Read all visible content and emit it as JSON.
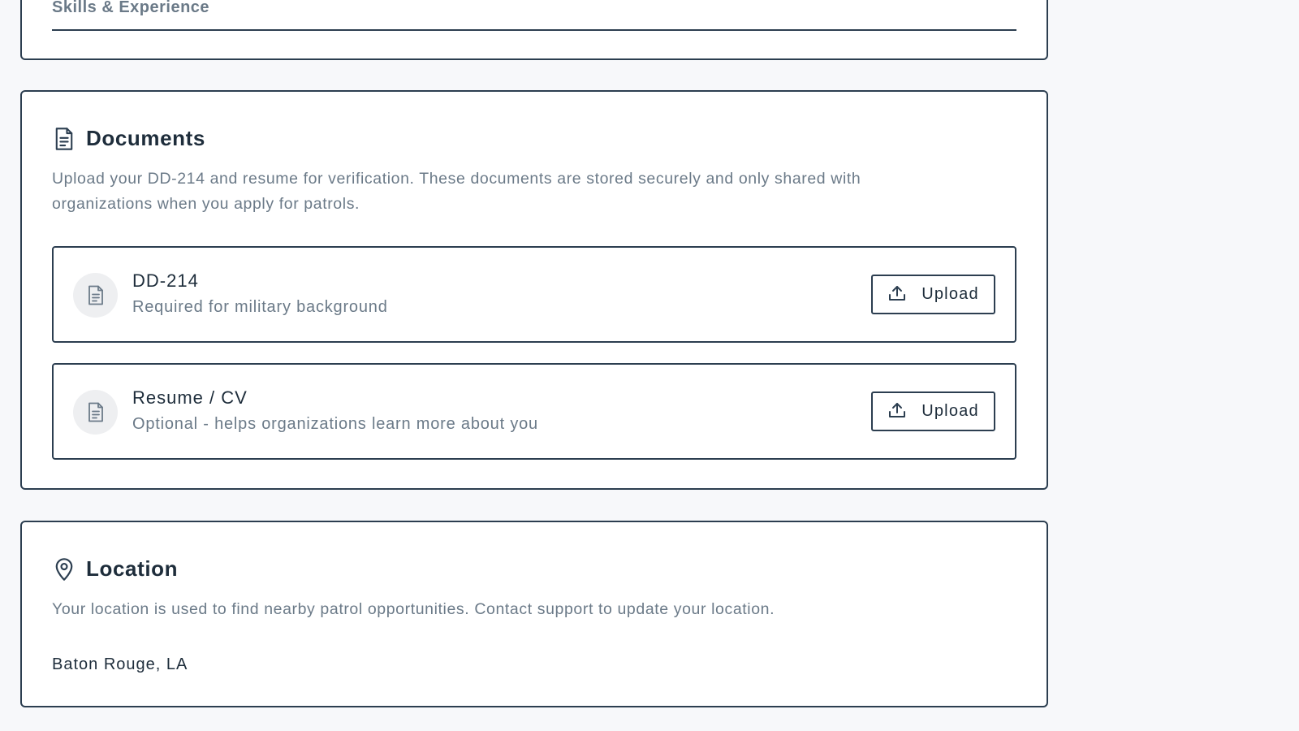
{
  "skills_section": {
    "heading": "Skills & Experience"
  },
  "documents_section": {
    "icon": "document-icon",
    "title": "Documents",
    "description": "Upload your DD-214 and resume for verification. These documents are stored securely and only shared with organizations when you apply for patrols.",
    "items": [
      {
        "icon": "document-icon",
        "name": "DD-214",
        "subtitle": "Required for military background",
        "button_icon": "upload-icon",
        "button_label": "Upload"
      },
      {
        "icon": "document-icon",
        "name": "Resume / CV",
        "subtitle": "Optional - helps organizations learn more about you",
        "button_icon": "upload-icon",
        "button_label": "Upload"
      }
    ]
  },
  "location_section": {
    "icon": "map-pin-icon",
    "title": "Location",
    "description": "Your location is used to find nearby patrol opportunities. Contact support to update your location.",
    "value": "Baton Rouge, LA"
  },
  "colors": {
    "border": "#2c3e50",
    "text_primary": "#1e2d3b",
    "text_muted": "#6b7a88",
    "background": "#f7f8fa",
    "card": "#ffffff"
  }
}
